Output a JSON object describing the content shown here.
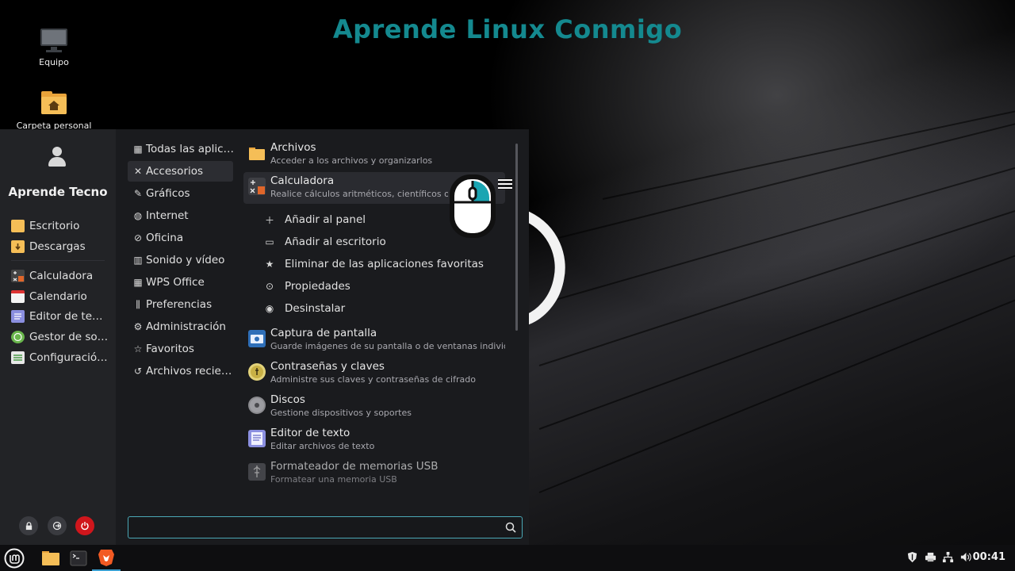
{
  "watermark": "Aprende Linux Conmigo",
  "desktop": {
    "icons": [
      {
        "label": "Equipo"
      },
      {
        "label": "Carpeta personal"
      }
    ]
  },
  "menu": {
    "username": "Aprende Tecno",
    "places": [
      {
        "label": "Escritorio"
      },
      {
        "label": "Descargas"
      }
    ],
    "favorites": [
      {
        "label": "Calculadora"
      },
      {
        "label": "Calendario"
      },
      {
        "label": "Editor de te…"
      },
      {
        "label": "Gestor de so…"
      },
      {
        "label": "Configuració…"
      }
    ],
    "categories": [
      {
        "label": "Todas las aplic…",
        "icon": "grid-icon"
      },
      {
        "label": "Accesorios",
        "icon": "tools-icon",
        "selected": true
      },
      {
        "label": "Gráficos",
        "icon": "paint-icon"
      },
      {
        "label": "Internet",
        "icon": "globe-icon"
      },
      {
        "label": "Oficina",
        "icon": "paperclip-icon"
      },
      {
        "label": "Sonido y vídeo",
        "icon": "media-icon"
      },
      {
        "label": "WPS Office",
        "icon": "grid-icon"
      },
      {
        "label": "Preferencias",
        "icon": "sliders-icon"
      },
      {
        "label": "Administración",
        "icon": "gear-icon"
      },
      {
        "label": "Favoritos",
        "icon": "star-icon"
      },
      {
        "label": "Archivos recie…",
        "icon": "history-icon"
      }
    ],
    "apps": [
      {
        "name": "Archivos",
        "desc": "Acceder a los archivos y organizarlos"
      },
      {
        "name": "Calculadora",
        "desc": "Realice cálculos aritméticos, científicos o financieros"
      }
    ],
    "context_menu": [
      {
        "label": "Añadir al panel",
        "icon": "plus-icon"
      },
      {
        "label": "Añadir al escritorio",
        "icon": "desktop-icon"
      },
      {
        "label": "Eliminar de las aplicaciones favoritas",
        "icon": "star-icon"
      },
      {
        "label": "Propiedades",
        "icon": "properties-icon"
      },
      {
        "label": "Desinstalar",
        "icon": "uninstall-icon"
      }
    ],
    "apps_more": [
      {
        "name": "Captura de pantalla",
        "desc": "Guarde imágenes de su pantalla o de ventanas individuales"
      },
      {
        "name": "Contraseñas y claves",
        "desc": "Administre sus claves y contraseñas de cifrado"
      },
      {
        "name": "Discos",
        "desc": "Gestione dispositivos y soportes"
      },
      {
        "name": "Editor de texto",
        "desc": "Editar archivos de texto"
      },
      {
        "name": "Formateador de memorias USB",
        "desc": "Formatear una memoria USB"
      }
    ],
    "search": {
      "value": "",
      "placeholder": ""
    }
  },
  "taskbar": {
    "clock": "00:41"
  },
  "colors": {
    "accent": "#4aa8b6",
    "watermark": "#14898f",
    "power": "#d0161c",
    "folder": "#f5be57"
  }
}
